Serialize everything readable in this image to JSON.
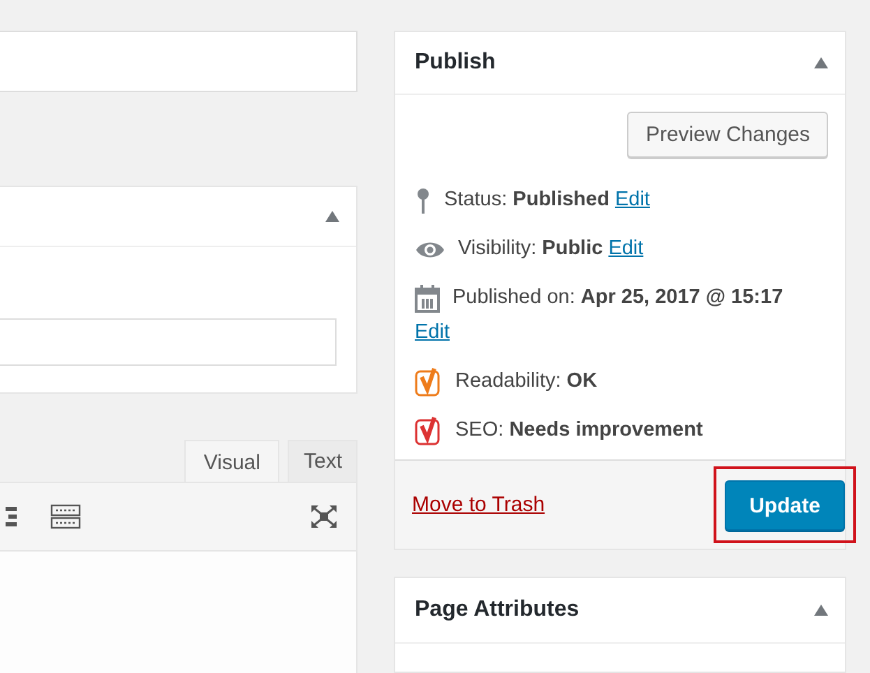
{
  "editor": {
    "metabox": {
      "expanded": true
    },
    "tabs": [
      {
        "label": "Visual",
        "selected": true
      },
      {
        "label": "Text",
        "selected": false
      }
    ]
  },
  "publish": {
    "title": "Publish",
    "expanded": true,
    "preview_button": "Preview Changes",
    "rows": [
      {
        "kind": "status",
        "label": "Status:",
        "value": "Published",
        "link": "Edit"
      },
      {
        "kind": "visibility",
        "label": "Visibility:",
        "value": "Public",
        "link": "Edit"
      },
      {
        "kind": "date",
        "label": "Published on:",
        "value": "Apr 25, 2017 @ 15:17",
        "link": "Edit"
      },
      {
        "kind": "yoast",
        "label": "Readability:",
        "value": "OK",
        "color": "#ee7c1b"
      },
      {
        "kind": "yoast",
        "label": "SEO:",
        "value": "Needs improvement",
        "color": "#dc3232"
      }
    ],
    "trash_link": "Move to Trash",
    "update_button": {
      "label": "Update",
      "highlighted": true
    }
  },
  "page_attributes": {
    "title": "Page Attributes",
    "expanded": true
  }
}
